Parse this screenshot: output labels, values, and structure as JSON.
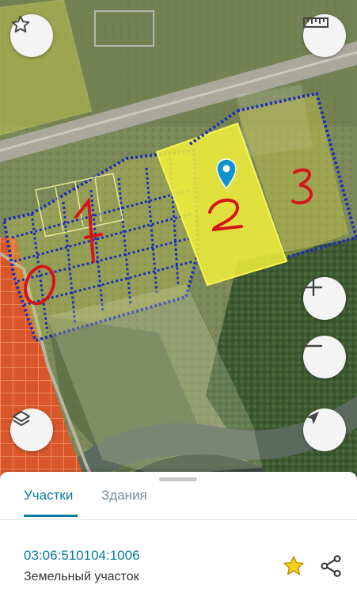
{
  "map": {
    "plot_labels": [
      "1",
      "2",
      "3"
    ],
    "accent_color": "#f2f03a",
    "buttons": {
      "favorite": "star-outline-icon",
      "ruler": "ruler-icon",
      "zoom_in": "plus-icon",
      "zoom_out": "minus-icon",
      "layers": "layers-icon",
      "locate": "navigation-arrow-icon"
    }
  },
  "sheet": {
    "tabs": [
      {
        "label": "Участки",
        "active": true
      },
      {
        "label": "Здания",
        "active": false
      }
    ],
    "result": {
      "cadastral_number": "03:06:510104:1006",
      "type": "Земельный участок"
    },
    "colors": {
      "accent": "#0a7aa3",
      "star": "#f5d21c"
    }
  }
}
